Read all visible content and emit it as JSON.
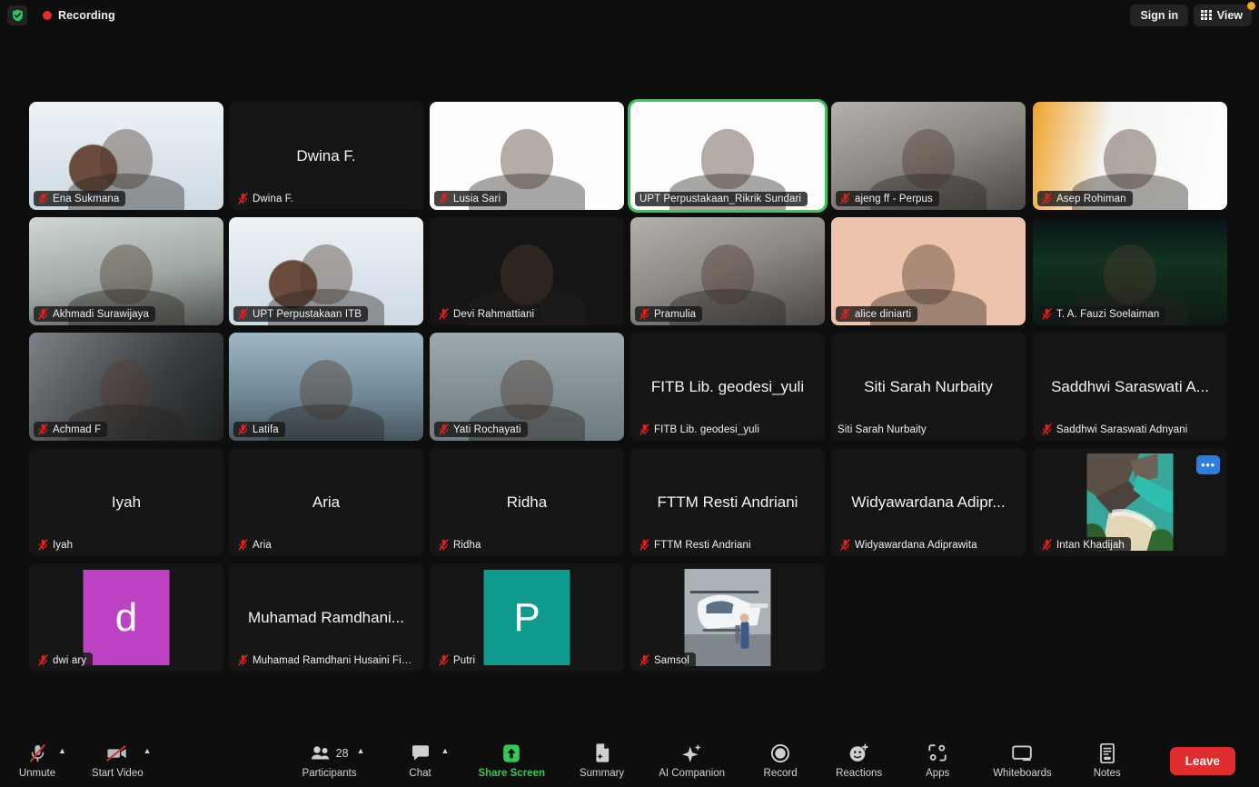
{
  "topbar": {
    "shield_icon": "shield-check-icon",
    "recording_label": "Recording",
    "recording_dot_color": "#e02d2d",
    "sign_in_label": "Sign in",
    "view_label": "View",
    "view_icon": "grid-view-icon",
    "badge_color": "#f5a623"
  },
  "theme": {
    "background": "#0e0e0e",
    "tile_background": "#1b1b1b",
    "active_speaker_border": "#35c759",
    "accent_green": "#35c759",
    "leave_red": "#e02d2d",
    "more_button_blue": "#2f7ce0"
  },
  "gallery": {
    "rows": [
      [
        {
          "name": "Ena Sukmana",
          "muted": true,
          "video": true,
          "style": "bg-a",
          "name_only": false,
          "active": false
        },
        {
          "name": "Dwina F.",
          "muted": true,
          "video": false,
          "style": "bg-dark",
          "name_only": true,
          "display": "Dwina F.",
          "active": false
        },
        {
          "name": "Lusia Sari",
          "muted": true,
          "video": true,
          "style": "bg-white",
          "name_only": false,
          "active": false
        },
        {
          "name": "UPT Perpustakaan_Rikrik Sundari",
          "muted": false,
          "video": true,
          "style": "bg-white",
          "name_only": false,
          "active": true
        },
        {
          "name": "ajeng ff - Perpus",
          "muted": true,
          "video": true,
          "style": "bg-blur-person",
          "name_only": false,
          "active": false
        },
        {
          "name": "Asep Rohiman",
          "muted": true,
          "video": true,
          "style": "bg-poster",
          "name_only": false,
          "active": false
        }
      ],
      [
        {
          "name": "Akhmadi Surawijaya",
          "muted": true,
          "video": true,
          "style": "bg-office",
          "name_only": false,
          "active": false
        },
        {
          "name": "UPT Perpustakaan ITB",
          "muted": true,
          "video": true,
          "style": "bg-a",
          "name_only": false,
          "active": false
        },
        {
          "name": "Devi Rahmattiani",
          "muted": true,
          "video": true,
          "style": "bg-dark",
          "name_only": false,
          "active": false
        },
        {
          "name": "Pramulia",
          "muted": true,
          "video": true,
          "style": "bg-blur-person",
          "name_only": false,
          "active": false
        },
        {
          "name": "alice diniarti",
          "muted": true,
          "video": true,
          "style": "bg-peach",
          "name_only": false,
          "active": false
        },
        {
          "name": "T. A. Fauzi Soelaiman",
          "muted": true,
          "video": true,
          "style": "bg-aurora",
          "name_only": false,
          "active": false
        }
      ],
      [
        {
          "name": "Achmad F",
          "muted": true,
          "video": true,
          "style": "bg-room",
          "name_only": false,
          "active": false
        },
        {
          "name": "Latifa",
          "muted": true,
          "video": true,
          "style": "bg-shelf",
          "name_only": false,
          "active": false
        },
        {
          "name": "Yati Rochayati",
          "muted": true,
          "video": true,
          "style": "bg-hijab",
          "name_only": false,
          "active": false
        },
        {
          "name": "FITB Lib. geodesi_yuli",
          "muted": true,
          "video": false,
          "style": "bg-dark",
          "name_only": true,
          "display": "FITB Lib. geodesi_yuli",
          "active": false
        },
        {
          "name": "Siti Sarah Nurbaity",
          "muted": false,
          "video": false,
          "style": "bg-dark",
          "name_only": true,
          "display": "Siti Sarah Nurbaity",
          "active": false
        },
        {
          "name": "Saddhwi Saraswati Adnyani",
          "muted": true,
          "video": false,
          "style": "bg-dark",
          "name_only": true,
          "display": "Saddhwi Saraswati A...",
          "active": false
        }
      ],
      [
        {
          "name": "Iyah",
          "muted": true,
          "video": false,
          "style": "bg-dark",
          "name_only": true,
          "display": "Iyah",
          "active": false
        },
        {
          "name": "Aria",
          "muted": true,
          "video": false,
          "style": "bg-dark",
          "name_only": true,
          "display": "Aria",
          "active": false
        },
        {
          "name": "Ridha",
          "muted": true,
          "video": false,
          "style": "bg-dark",
          "name_only": true,
          "display": "Ridha",
          "active": false
        },
        {
          "name": "FTTM Resti Andriani",
          "muted": true,
          "video": false,
          "style": "bg-dark",
          "name_only": true,
          "display": "FTTM Resti Andriani",
          "active": false
        },
        {
          "name": "Widyawardana Adiprawita",
          "muted": true,
          "video": false,
          "style": "bg-dark",
          "name_only": true,
          "display": "Widyawardana Adipr...",
          "active": false
        },
        {
          "name": "Intan Khadijah",
          "muted": true,
          "video": false,
          "style": "bg-dark",
          "name_only": false,
          "photo": "beach",
          "has_more": true,
          "more_label": "•••",
          "active": false
        }
      ],
      [
        {
          "name": "dwi ary",
          "muted": true,
          "video": false,
          "style": "bg-dark",
          "name_only": false,
          "avatar_letter": "d",
          "avatar_color": "#bd43c4",
          "active": false
        },
        {
          "name": "Muhamad Ramdhani Husaini Fikri",
          "muted": true,
          "video": false,
          "style": "bg-dark",
          "name_only": true,
          "display": "Muhamad Ramdhani...",
          "active": false
        },
        {
          "name": "Putri",
          "muted": true,
          "video": false,
          "style": "bg-dark",
          "name_only": false,
          "avatar_letter": "P",
          "avatar_color": "#0f9b8e",
          "active": false
        },
        {
          "name": "Samsol",
          "muted": true,
          "video": false,
          "style": "bg-dark",
          "name_only": false,
          "photo": "heli",
          "active": false
        }
      ]
    ]
  },
  "toolbar": {
    "mute": {
      "label": "Unmute",
      "icon": "mic-muted-icon",
      "has_caret": true
    },
    "video": {
      "label": "Start Video",
      "icon": "video-off-icon",
      "has_caret": true
    },
    "participants": {
      "label": "Participants",
      "icon": "people-icon",
      "count": "28",
      "has_caret": true
    },
    "chat": {
      "label": "Chat",
      "icon": "chat-bubble-icon",
      "has_caret": true
    },
    "share": {
      "label": "Share Screen",
      "icon": "share-screen-up-arrow-icon"
    },
    "summary": {
      "label": "Summary",
      "icon": "summary-doc-icon"
    },
    "ai": {
      "label": "AI Companion",
      "icon": "ai-sparkle-icon"
    },
    "record": {
      "label": "Record",
      "icon": "record-circle-icon"
    },
    "reactions": {
      "label": "Reactions",
      "icon": "smiley-plus-icon"
    },
    "apps": {
      "label": "Apps",
      "icon": "apps-bracket-icon"
    },
    "whiteboards": {
      "label": "Whiteboards",
      "icon": "whiteboard-icon"
    },
    "notes": {
      "label": "Notes",
      "icon": "notes-icon"
    },
    "leave": {
      "label": "Leave"
    }
  }
}
